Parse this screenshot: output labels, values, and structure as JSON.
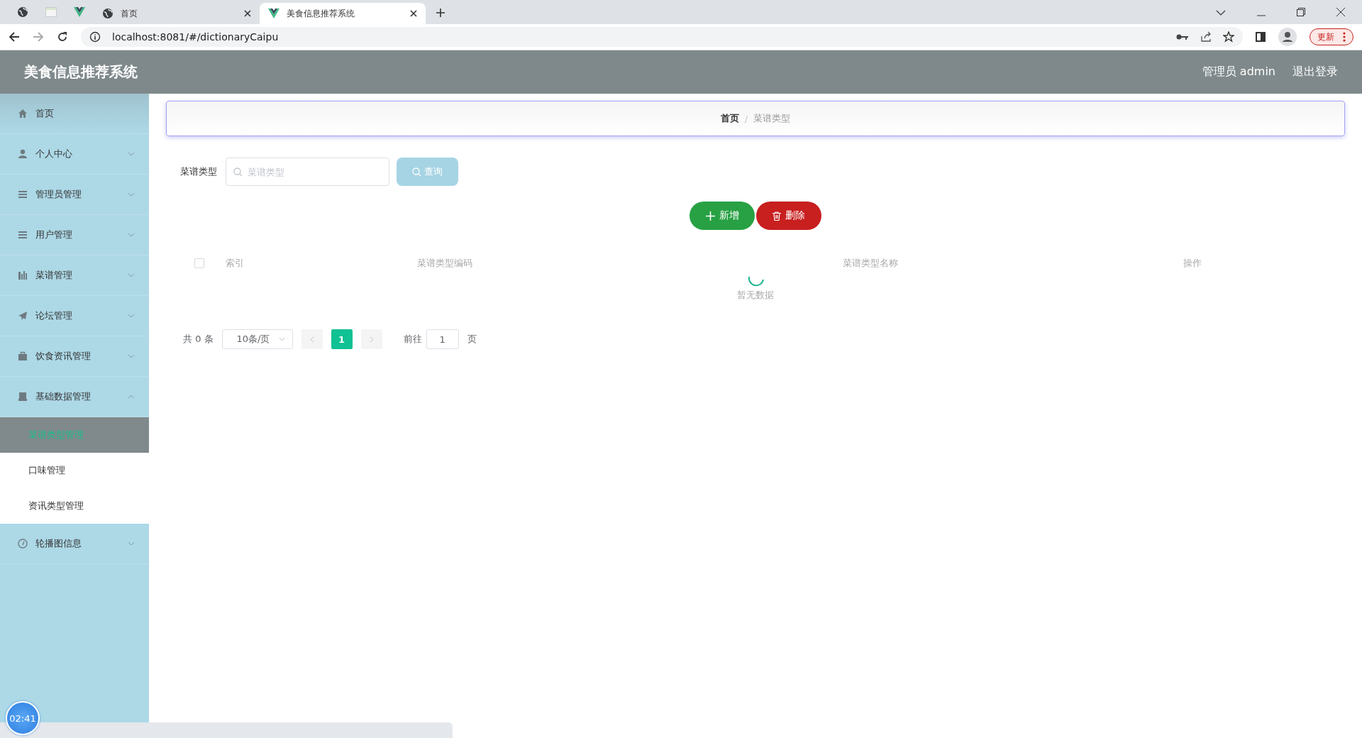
{
  "browser": {
    "pinned_tabs": [
      {
        "kind": "globe"
      },
      {
        "kind": "page"
      },
      {
        "kind": "vue"
      }
    ],
    "tabs": [
      {
        "kind": "globe",
        "title": "首页",
        "selected": false
      },
      {
        "kind": "vue",
        "title": "美食信息推荐系统",
        "selected": true
      }
    ],
    "url": "localhost:8081/#/dictionaryCaipu",
    "update_button": "更新"
  },
  "header": {
    "title": "美食信息推荐系统",
    "user": "管理员 admin",
    "logout": "退出登录"
  },
  "sidebar": {
    "items": [
      {
        "kind": "home",
        "label": "首页"
      },
      {
        "kind": "user",
        "label": "个人中心",
        "expanded": false
      },
      {
        "kind": "list",
        "label": "管理员管理",
        "expanded": false
      },
      {
        "kind": "list",
        "label": "用户管理",
        "expanded": false
      },
      {
        "kind": "chart",
        "label": "菜谱管理",
        "expanded": false
      },
      {
        "kind": "plane",
        "label": "论坛管理",
        "expanded": false
      },
      {
        "kind": "briefcase",
        "label": "饮食资讯管理",
        "expanded": false
      },
      {
        "kind": "box",
        "label": "基础数据管理",
        "expanded": true,
        "children": [
          {
            "label": "菜谱类型管理",
            "selected": true
          },
          {
            "label": "口味管理",
            "selected": false
          },
          {
            "label": "资讯类型管理",
            "selected": false
          }
        ]
      },
      {
        "kind": "gauge",
        "label": "轮播图信息",
        "expanded": false
      }
    ]
  },
  "breadcrumb": [
    "首页",
    "菜谱类型"
  ],
  "breadcrumb_separator": "/",
  "search": {
    "label": "菜谱类型",
    "placeholder": "菜谱类型",
    "button": "查询"
  },
  "actions": [
    {
      "kind": "add",
      "label": "新增"
    },
    {
      "kind": "delete",
      "label": "删除"
    }
  ],
  "table": {
    "select_all_checked": false,
    "columns": [
      "索引",
      "菜谱类型编码",
      "菜谱类型名称",
      "操作"
    ],
    "empty_text": "暂无数据",
    "loading": true
  },
  "pagination": {
    "total": "共 0 条",
    "page_size": "10条/页",
    "pages": [
      {
        "label": "1",
        "selected": true
      }
    ],
    "goto_label": "前往",
    "goto_value": "1",
    "goto_suffix": "页"
  },
  "timer": "02:41"
}
